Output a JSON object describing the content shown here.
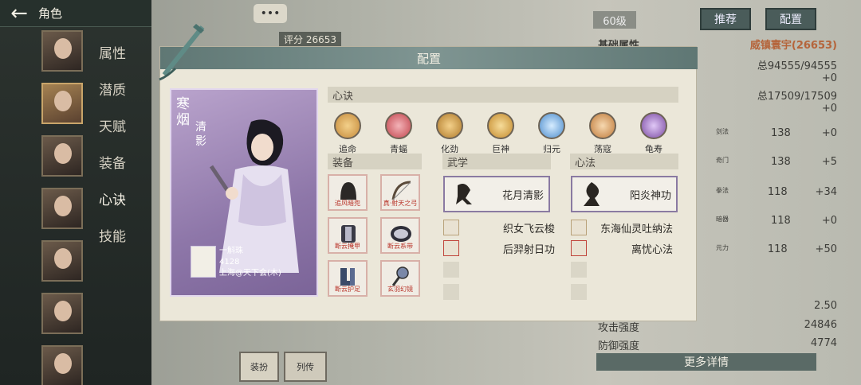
{
  "header": {
    "title": "角色"
  },
  "sidebar": {
    "tabs": [
      "属性",
      "潜质",
      "天赋",
      "装备",
      "心诀",
      "技能"
    ]
  },
  "right_panel": {
    "level": "60级",
    "recommend": "推荐",
    "config": "配置",
    "score_label": "评分",
    "score": "26653",
    "base_attr": "基础属性",
    "title_badge": "威镇寰宇(26653)",
    "stat_rows": [
      {
        "left": "总94555/94555",
        "right": "+0"
      },
      {
        "left": "总17509/17509",
        "right": "+0"
      }
    ],
    "elem_rows": [
      {
        "label": "剑法",
        "value": "138",
        "bonus": "+0"
      },
      {
        "label": "奇门",
        "value": "138",
        "bonus": "+5"
      },
      {
        "label": "拳法",
        "value": "118",
        "bonus": "+34"
      },
      {
        "label": "暗器",
        "value": "118",
        "bonus": "+0"
      },
      {
        "label": "元力",
        "value": "118",
        "bonus": "+50"
      }
    ],
    "bottom_rows": [
      {
        "label": "",
        "value": "2.50"
      },
      {
        "label": "攻击强度",
        "value": "24846"
      },
      {
        "label": "防御强度",
        "value": "4774"
      }
    ],
    "more_details": "更多详情"
  },
  "bottom_icons": {
    "left": "装扮",
    "right": "列传"
  },
  "modal": {
    "title": "配置",
    "hero": {
      "name_a": "寒烟",
      "name_b": "清影",
      "player_name": "一斛珠",
      "player_score": "4128",
      "player_server": "上海@天下会(木)"
    },
    "xinjue_label": "心诀",
    "xinjue": [
      {
        "label": "追命",
        "color": "#c58a3a"
      },
      {
        "label": "青蝠",
        "color": "#c2444c"
      },
      {
        "label": "化劲",
        "color": "#b07a2a"
      },
      {
        "label": "巨神",
        "color": "#c48a2c"
      },
      {
        "label": "归元",
        "color": "#4c8ccc"
      },
      {
        "label": "荡寇",
        "color": "#c07a3a"
      },
      {
        "label": "龟寿",
        "color": "#7a4aa2"
      }
    ],
    "equip_label": "装备",
    "equipment": [
      {
        "name": "追风暗兜",
        "icon": "hood-icon"
      },
      {
        "name": "真·射天之弓",
        "icon": "bow-icon"
      },
      {
        "name": "断云掩甲",
        "icon": "armor-icon"
      },
      {
        "name": "断云系带",
        "icon": "belt-icon"
      },
      {
        "name": "断云护足",
        "icon": "boots-icon"
      },
      {
        "name": "玄羽幻镜",
        "icon": "mirror-icon"
      }
    ],
    "wuxue_label": "武学",
    "wuxue_main": "花月清影",
    "wuxue_list": [
      "织女飞云梭",
      "后羿射日功"
    ],
    "xinfa_label": "心法",
    "xinfa_main": "阳炎神功",
    "xinfa_list": [
      "东海仙灵吐纳法",
      "离忧心法"
    ]
  }
}
